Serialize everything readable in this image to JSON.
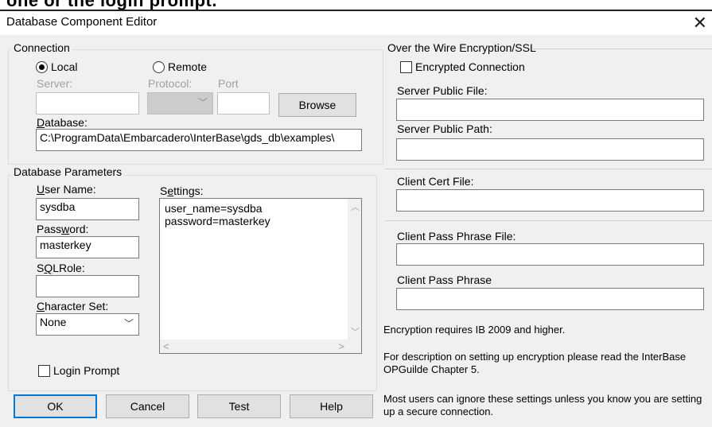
{
  "header_banner": "one or the login prompt.",
  "window": {
    "title": "Database Component Editor",
    "close": "✕"
  },
  "connection": {
    "legend": "Connection",
    "local_label": "Local",
    "remote_label": "Remote",
    "selected": "Local",
    "server_label": "Server:",
    "server_value": "",
    "protocol_label": "Protocol:",
    "protocol_value": "",
    "port_label": "Port",
    "port_value": "",
    "browse_label": "Browse",
    "database_label": "Database:",
    "database_value": "C:\\ProgramData\\Embarcadero\\InterBase\\gds_db\\examples\\"
  },
  "params": {
    "legend": "Database Parameters",
    "username_label": "User Name:",
    "username_value": "sysdba",
    "password_label": "Password:",
    "password_value": "masterkey",
    "sqlrole_label": "SQLRole:",
    "sqlrole_value": "",
    "charset_label": "Character Set:",
    "charset_value": "None",
    "settings_label": "Settings:",
    "settings_lines": "user_name=sysdba\npassword=masterkey",
    "login_prompt_label": "Login Prompt"
  },
  "ssl": {
    "legend": "Over the Wire Encryption/SSL",
    "encrypted_label": "Encrypted Connection",
    "server_public_file_label": "Server Public File:",
    "server_public_file_value": "",
    "server_public_path_label": "Server Public Path:",
    "server_public_path_value": "",
    "client_cert_file_label": "Client Cert File:",
    "client_cert_file_value": "",
    "client_pass_phrase_file_label": "Client Pass Phrase File:",
    "client_pass_phrase_file_value": "",
    "client_pass_phrase_label": "Client Pass Phrase",
    "client_pass_phrase_value": "",
    "note1": "Encryption requires IB 2009 and higher.",
    "note2": "For description on setting up encryption please read the InterBase OPGuilde Chapter 5.",
    "note3": "Most users can ignore these settings unless you know you are setting up a secure connection."
  },
  "buttons": {
    "ok": "OK",
    "cancel": "Cancel",
    "test": "Test",
    "help": "Help"
  }
}
